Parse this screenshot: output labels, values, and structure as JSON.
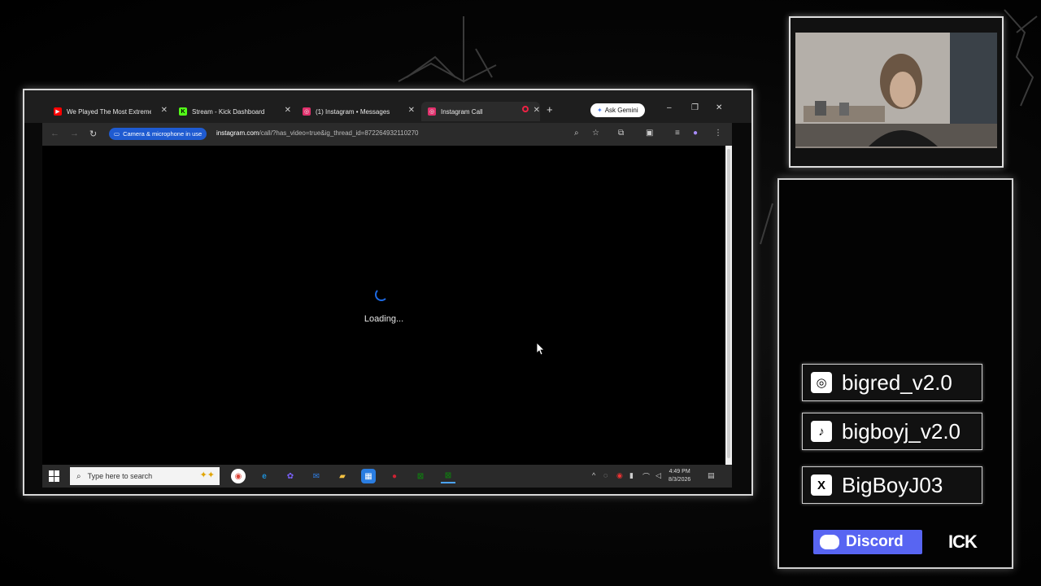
{
  "browser": {
    "tabs": [
      {
        "label": "We Played The Most Extreme",
        "icon": "youtube-icon",
        "color": "#ff0000"
      },
      {
        "label": "Stream - Kick Dashboard",
        "icon": "kick-icon",
        "color": "#53fc18"
      },
      {
        "label": "(1) Instagram • Messages",
        "icon": "instagram-icon",
        "color": "#e1306c"
      },
      {
        "label": "Instagram Call",
        "icon": "instagram-icon",
        "color": "#e1306c",
        "active": true
      }
    ],
    "new_tab_glyph": "+",
    "ask_gemini_label": "Ask Gemini",
    "window_controls": {
      "minimize": "–",
      "restore": "❐",
      "close": "✕"
    },
    "toolbar": {
      "camera_chip_label": "Camera & microphone in use",
      "url_host": "instagram.com",
      "url_path": "/call/?has_video=true&ig_thread_id=872264932110270"
    },
    "page": {
      "loading_text": "Loading..."
    }
  },
  "taskbar": {
    "search_placeholder": "Type here to search",
    "apps": [
      {
        "name": "chrome-icon",
        "color": "#db4437"
      },
      {
        "name": "edge-icon",
        "color": "#1e90d8"
      },
      {
        "name": "copilot-icon",
        "color": "#7b61ff"
      },
      {
        "name": "mail-icon",
        "color": "#2f7de1"
      },
      {
        "name": "file-explorer-icon",
        "color": "#f5c242"
      },
      {
        "name": "store-icon",
        "color": "#2a7de1"
      },
      {
        "name": "app-icon",
        "color": "#cc2233"
      },
      {
        "name": "xbox-icon",
        "color": "#107c10"
      },
      {
        "name": "xbox-game-bar-icon",
        "color": "#107c10"
      }
    ],
    "clock_time": "4:49 PM",
    "clock_date": "8/3/2026"
  },
  "socials": {
    "instagram": "bigred_v2.0",
    "tiktok": "bigboyj_v2.0",
    "x": "BigBoyJ03",
    "discord_label": "Discord",
    "kick_label": "ICK"
  },
  "colors": {
    "accent_blue": "#1f5bd1",
    "discord": "#5865f2"
  }
}
